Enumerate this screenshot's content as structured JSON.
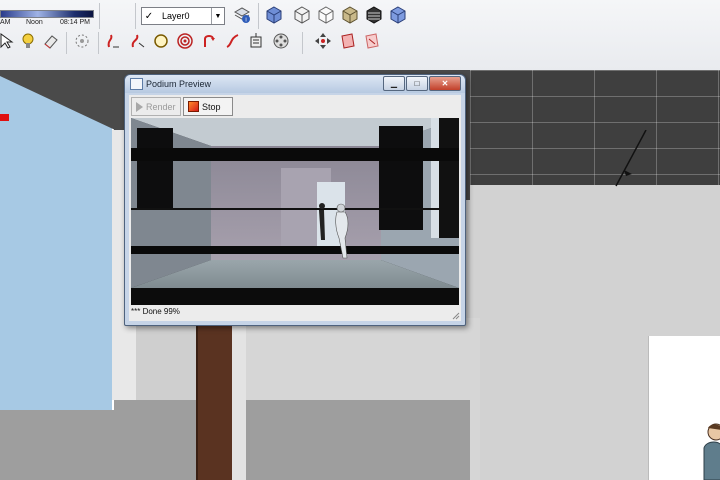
{
  "toolbar": {
    "shadow": {
      "am": "AM",
      "noon": "Noon",
      "time": "08:14 PM"
    },
    "layer": {
      "check": "✓",
      "name": "Layer0"
    },
    "icons": [
      "select-icon",
      "paint-bucket-icon",
      "eraser-icon",
      "orbit-icon",
      "arc-tool-icon",
      "offset-icon",
      "circle-icon",
      "target-icon",
      "rotate-icon",
      "follow-me-icon",
      "tape-measure-icon",
      "position-camera-icon",
      "walk-icon",
      "section-plane-icon",
      "section-display-icon",
      "layer-manager-icon",
      "iso-view-icon",
      "top-view-icon",
      "front-view-icon",
      "right-view-icon",
      "back-view-icon",
      "left-view-icon"
    ]
  },
  "preview_window": {
    "title": "Podium Preview",
    "render_label": "Render",
    "stop_label": "Stop",
    "status": "*** Done 99%",
    "controls": {
      "minimize": "▁",
      "maximize": "□",
      "close": "✕"
    }
  },
  "colors": {
    "glass": "#a7c9e4",
    "ceiling": "#4a4a4a",
    "pillar": "#5a3321",
    "stop_icon": "#e2411a"
  }
}
